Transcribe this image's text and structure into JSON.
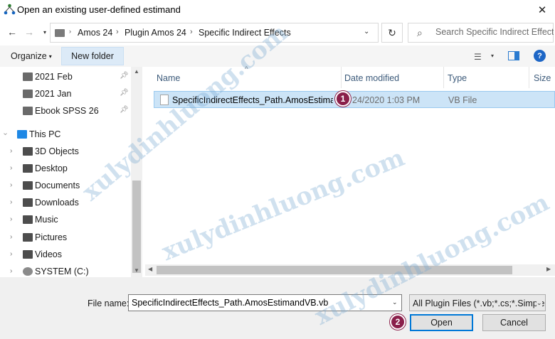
{
  "window": {
    "title": "Open an existing user-defined estimand",
    "close_glyph": "✕"
  },
  "address": {
    "breadcrumbs": [
      "Amos 24",
      "Plugin Amos 24",
      "Specific Indirect Effects"
    ],
    "search_placeholder": "Search Specific Indirect Effects"
  },
  "toolbar": {
    "organize_label": "Organize",
    "new_folder_label": "New folder"
  },
  "nav": {
    "quick_access": [
      {
        "label": "2021 Feb"
      },
      {
        "label": "2021 Jan"
      },
      {
        "label": "Ebook SPSS 26"
      }
    ],
    "this_pc_label": "This PC",
    "pc_items": [
      {
        "label": "3D Objects"
      },
      {
        "label": "Desktop"
      },
      {
        "label": "Documents"
      },
      {
        "label": "Downloads"
      },
      {
        "label": "Music"
      },
      {
        "label": "Pictures"
      },
      {
        "label": "Videos"
      },
      {
        "label": "SYSTEM (C:)"
      }
    ]
  },
  "columns": {
    "name": "Name",
    "date": "Date modified",
    "type": "Type",
    "size": "Size"
  },
  "files": [
    {
      "name": "SpecificIndirectEffects_Path.AmosEstiman...",
      "date": "24/2020 1:03 PM",
      "type": "VB File"
    }
  ],
  "footer": {
    "file_name_label": "File name:",
    "file_name_value": "SpecificIndirectEffects_Path.AmosEstimandVB.vb",
    "filter_value": "All Plugin Files (*.vb;*.cs;*.Simple",
    "open_label": "Open",
    "cancel_label": "Cancel"
  },
  "badges": {
    "step1": "1",
    "step2": "2"
  },
  "watermark": "xulydinhluong.com",
  "colors": {
    "selection": "#cce4f7",
    "accent": "#0078d7",
    "badge": "#8a1f4a"
  }
}
